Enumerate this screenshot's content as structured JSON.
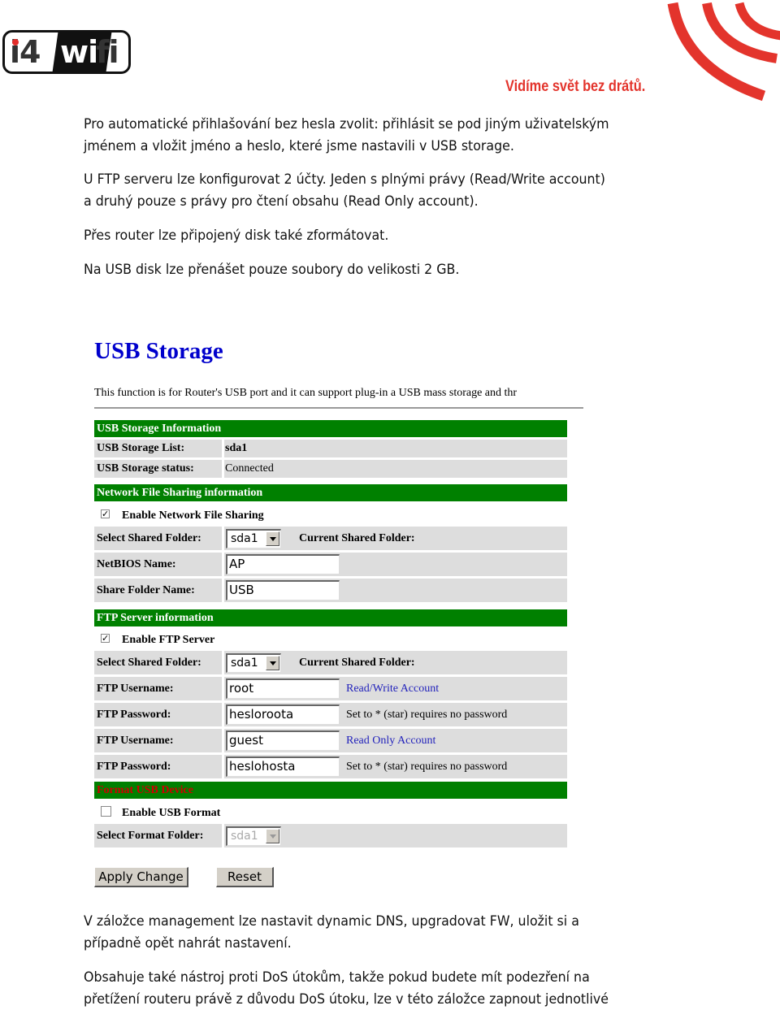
{
  "header": {
    "logo": {
      "part1": "i4",
      "part2": "wi",
      "part3": "fi"
    },
    "tagline": "Vidíme svět bez drátů.",
    "brand_color": "#e3342c"
  },
  "intro_paragraphs": [
    {
      "lines": [
        "Pro automatické přihlašování bez hesla zvolit: přihlásit se pod jiným uživatelským",
        "jménem a vložit jméno a heslo, které jsme nastavili v USB storage."
      ]
    },
    {
      "lines": [
        "U FTP serveru lze konfigurovat 2 účty. Jeden s plnými právy (Read/Write account)",
        "a druhý pouze s právy pro čtení obsahu (Read Only account)."
      ]
    },
    {
      "lines": [
        "Přes router lze připojený disk také zformátovat."
      ]
    },
    {
      "lines": [
        "Na USB disk lze přenášet pouze soubory do velikosti 2 GB."
      ]
    }
  ],
  "router": {
    "title": "USB Storage",
    "description": "This function is for Router's USB port and it can support plug-in a USB mass storage and thr",
    "usb_info": {
      "header": "USB Storage Information",
      "list_label": "USB Storage List:",
      "list_value": "sda1",
      "status_label": "USB Storage status:",
      "status_value": "Connected"
    },
    "nfs": {
      "header": "Network File Sharing information",
      "enable_label": "Enable Network File Sharing",
      "enable_checked": "✓",
      "folder_label": "Select Shared Folder:",
      "folder_value": "sda1",
      "current_label": "Current Shared Folder:",
      "netbios_label": "NetBIOS Name:",
      "netbios_value": "AP",
      "share_label": "Share Folder Name:",
      "share_value": "USB"
    },
    "ftp": {
      "header": "FTP Server information",
      "enable_label": "Enable FTP Server",
      "enable_checked": "✓",
      "folder_label": "Select Shared Folder:",
      "folder_value": "sda1",
      "current_label": "Current Shared Folder:",
      "accounts": [
        {
          "user_label": "FTP Username:",
          "user_value": "root",
          "account_type": "Read/Write Account",
          "pass_label": "FTP Password:",
          "pass_value": "hesloroota",
          "pass_note": "Set to * (star) requires no password"
        },
        {
          "user_label": "FTP Username:",
          "user_value": "guest",
          "account_type": "Read Only Account",
          "pass_label": "FTP Password:",
          "pass_value": "heslohosta",
          "pass_note": "Set to * (star) requires no password"
        }
      ]
    },
    "format": {
      "header": "Format USB Device",
      "enable_label": "Enable USB Format",
      "enable_checked": "",
      "folder_label": "Select Format Folder:",
      "folder_value": "sda1"
    },
    "buttons": {
      "apply": "Apply Change",
      "reset": "Reset"
    },
    "colors": {
      "section_bg": "#008000",
      "row_bg": "#dddddd",
      "title": "#0000cc"
    }
  },
  "outro_paragraphs": [
    {
      "lines": [
        "V záložce management lze nastavit dynamic DNS, upgradovat FW, uložit si a",
        "případně opět nahrát nastavení."
      ]
    },
    {
      "lines": [
        "Obsahuje také nástroj proti DoS útokům, takže pokud budete mít podezření na",
        "přetížení routeru právě z důvodu DoS útoku, lze v této záložce zapnout jednotlivé"
      ]
    }
  ]
}
